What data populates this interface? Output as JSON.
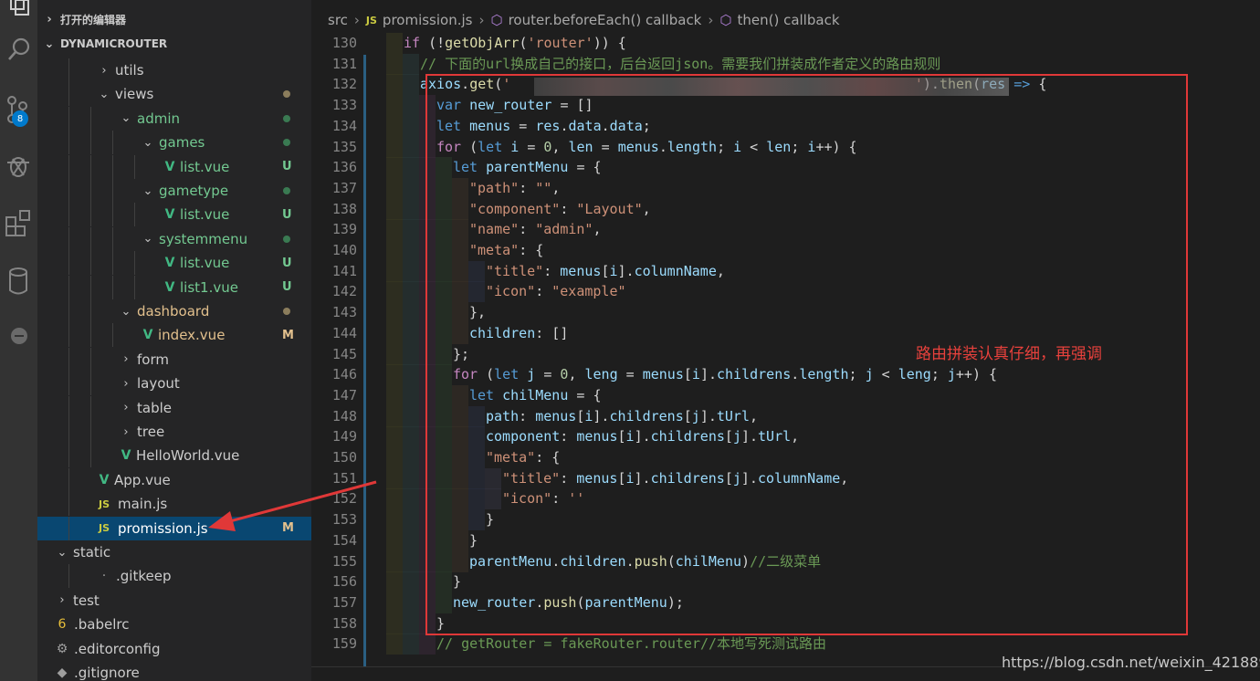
{
  "sidebar": {
    "open_editors": "打开的编辑器",
    "project": "DYNAMICROUTER",
    "activity_badge": "8",
    "tree": [
      {
        "label": "utils",
        "kind": "folder",
        "open": false,
        "depth": 1
      },
      {
        "label": "views",
        "kind": "folder",
        "open": true,
        "depth": 1,
        "status": "dot",
        "color": "#8b7d5c"
      },
      {
        "label": "admin",
        "kind": "folder",
        "open": true,
        "depth": 2,
        "status": "dot",
        "color": "#3a7a52",
        "text_color": "#73c991"
      },
      {
        "label": "games",
        "kind": "folder",
        "open": true,
        "depth": 3,
        "status": "dot",
        "color": "#3a7a52",
        "text_color": "#73c991"
      },
      {
        "label": "list.vue",
        "kind": "vue",
        "depth": 4,
        "status": "U",
        "text_color": "#73c991"
      },
      {
        "label": "gametype",
        "kind": "folder",
        "open": true,
        "depth": 3,
        "status": "dot",
        "color": "#3a7a52",
        "text_color": "#73c991"
      },
      {
        "label": "list.vue",
        "kind": "vue",
        "depth": 4,
        "status": "U",
        "text_color": "#73c991"
      },
      {
        "label": "systemmenu",
        "kind": "folder",
        "open": true,
        "depth": 3,
        "status": "dot",
        "color": "#3a7a52",
        "text_color": "#73c991"
      },
      {
        "label": "list.vue",
        "kind": "vue",
        "depth": 4,
        "status": "U",
        "text_color": "#73c991"
      },
      {
        "label": "list1.vue",
        "kind": "vue",
        "depth": 4,
        "status": "U",
        "text_color": "#73c991"
      },
      {
        "label": "dashboard",
        "kind": "folder",
        "open": true,
        "depth": 2,
        "status": "dot",
        "color": "#8b7d5c",
        "text_color": "#e2c08d"
      },
      {
        "label": "index.vue",
        "kind": "vue",
        "depth": 3,
        "status": "M",
        "text_color": "#e2c08d"
      },
      {
        "label": "form",
        "kind": "folder",
        "open": false,
        "depth": 2
      },
      {
        "label": "layout",
        "kind": "folder",
        "open": false,
        "depth": 2
      },
      {
        "label": "table",
        "kind": "folder",
        "open": false,
        "depth": 2
      },
      {
        "label": "tree",
        "kind": "folder",
        "open": false,
        "depth": 2
      },
      {
        "label": "HelloWorld.vue",
        "kind": "vue",
        "depth": 2
      },
      {
        "label": "App.vue",
        "kind": "vue",
        "depth": 1
      },
      {
        "label": "main.js",
        "kind": "js",
        "depth": 1
      },
      {
        "label": "promission.js",
        "kind": "js",
        "depth": 1,
        "status": "M",
        "selected": true
      },
      {
        "label": "static",
        "kind": "folder",
        "open": true,
        "depth": 0
      },
      {
        "label": ".gitkeep",
        "kind": "file",
        "depth": 1
      },
      {
        "label": "test",
        "kind": "folder",
        "open": false,
        "depth": 0
      },
      {
        "label": ".babelrc",
        "kind": "babel",
        "depth": 0
      },
      {
        "label": ".editorconfig",
        "kind": "gear",
        "depth": 0
      },
      {
        "label": ".gitignore",
        "kind": "git",
        "depth": 0
      }
    ]
  },
  "breadcrumb": {
    "root": "src",
    "file": "promission.js",
    "fn1": "router.beforeEach() callback",
    "fn2": "then() callback",
    "js_badge": "JS"
  },
  "editor": {
    "lines": [
      {
        "n": "130",
        "indent": 1,
        "t": [
          [
            "kw",
            "if "
          ],
          [
            "pn",
            "(!"
          ],
          [
            "fn",
            "getObjArr"
          ],
          [
            "pn",
            "("
          ],
          [
            "st",
            "'router'"
          ],
          [
            "pn",
            ")) {"
          ]
        ]
      },
      {
        "n": "131",
        "indent": 2,
        "t": [
          [
            "cm",
            "// 下面的url换成自己的接口，后台返回json。需要我们拼装成作者定义的路由规则"
          ]
        ]
      },
      {
        "n": "132",
        "indent": 2,
        "t": [
          [
            "vr",
            "axios"
          ],
          [
            "pn",
            "."
          ],
          [
            "fn",
            "get"
          ],
          [
            "pn",
            "("
          ],
          [
            "st",
            "'"
          ],
          [
            "pn",
            "                                                 "
          ],
          [
            "st",
            "'"
          ],
          [
            "pn",
            ")."
          ],
          [
            "fn",
            "then"
          ],
          [
            "pn",
            "("
          ],
          [
            "vr",
            "res"
          ],
          [
            "kwb",
            " =>"
          ],
          [
            "pn",
            " {"
          ]
        ]
      },
      {
        "n": "133",
        "indent": 3,
        "t": [
          [
            "kwb",
            "var "
          ],
          [
            "vr",
            "new_router"
          ],
          [
            "pn",
            " = []"
          ]
        ]
      },
      {
        "n": "134",
        "indent": 3,
        "t": [
          [
            "kwb",
            "let "
          ],
          [
            "vr",
            "menus"
          ],
          [
            "pn",
            " = "
          ],
          [
            "vr",
            "res"
          ],
          [
            "pn",
            "."
          ],
          [
            "vr",
            "data"
          ],
          [
            "pn",
            "."
          ],
          [
            "vr",
            "data"
          ],
          [
            "pn",
            ";"
          ]
        ]
      },
      {
        "n": "135",
        "indent": 3,
        "t": [
          [
            "kw",
            "for "
          ],
          [
            "pn",
            "("
          ],
          [
            "kwb",
            "let "
          ],
          [
            "vr",
            "i"
          ],
          [
            "pn",
            " = "
          ],
          [
            "nm",
            "0"
          ],
          [
            "pn",
            ", "
          ],
          [
            "vr",
            "len"
          ],
          [
            "pn",
            " = "
          ],
          [
            "vr",
            "menus"
          ],
          [
            "pn",
            "."
          ],
          [
            "vr",
            "length"
          ],
          [
            "pn",
            "; "
          ],
          [
            "vr",
            "i"
          ],
          [
            "pn",
            " < "
          ],
          [
            "vr",
            "len"
          ],
          [
            "pn",
            "; "
          ],
          [
            "vr",
            "i"
          ],
          [
            "pn",
            "++) {"
          ]
        ]
      },
      {
        "n": "136",
        "indent": 4,
        "t": [
          [
            "kwb",
            "let "
          ],
          [
            "vr",
            "parentMenu"
          ],
          [
            "pn",
            " = {"
          ]
        ]
      },
      {
        "n": "137",
        "indent": 5,
        "t": [
          [
            "st",
            "\"path\""
          ],
          [
            "pn",
            ": "
          ],
          [
            "st",
            "\"\""
          ],
          [
            "pn",
            ","
          ]
        ]
      },
      {
        "n": "138",
        "indent": 5,
        "t": [
          [
            "st",
            "\"component\""
          ],
          [
            "pn",
            ": "
          ],
          [
            "st",
            "\"Layout\""
          ],
          [
            "pn",
            ","
          ]
        ]
      },
      {
        "n": "139",
        "indent": 5,
        "t": [
          [
            "st",
            "\"name\""
          ],
          [
            "pn",
            ": "
          ],
          [
            "st",
            "\"admin\""
          ],
          [
            "pn",
            ","
          ]
        ]
      },
      {
        "n": "140",
        "indent": 5,
        "t": [
          [
            "st",
            "\"meta\""
          ],
          [
            "pn",
            ": {"
          ]
        ]
      },
      {
        "n": "141",
        "indent": 6,
        "t": [
          [
            "st",
            "\"title\""
          ],
          [
            "pn",
            ": "
          ],
          [
            "vr",
            "menus"
          ],
          [
            "pn",
            "["
          ],
          [
            "vr",
            "i"
          ],
          [
            "pn",
            "]."
          ],
          [
            "vr",
            "columnName"
          ],
          [
            "pn",
            ","
          ]
        ]
      },
      {
        "n": "142",
        "indent": 6,
        "t": [
          [
            "st",
            "\"icon\""
          ],
          [
            "pn",
            ": "
          ],
          [
            "st",
            "\"example\""
          ]
        ]
      },
      {
        "n": "143",
        "indent": 5,
        "t": [
          [
            "pn",
            "},"
          ]
        ]
      },
      {
        "n": "144",
        "indent": 5,
        "t": [
          [
            "vr",
            "children"
          ],
          [
            "pn",
            ": []"
          ]
        ]
      },
      {
        "n": "145",
        "indent": 4,
        "t": [
          [
            "pn",
            "};"
          ]
        ]
      },
      {
        "n": "146",
        "indent": 4,
        "t": [
          [
            "kw",
            "for "
          ],
          [
            "pn",
            "("
          ],
          [
            "kwb",
            "let "
          ],
          [
            "vr",
            "j"
          ],
          [
            "pn",
            " = "
          ],
          [
            "nm",
            "0"
          ],
          [
            "pn",
            ", "
          ],
          [
            "vr",
            "leng"
          ],
          [
            "pn",
            " = "
          ],
          [
            "vr",
            "menus"
          ],
          [
            "pn",
            "["
          ],
          [
            "vr",
            "i"
          ],
          [
            "pn",
            "]."
          ],
          [
            "vr",
            "childrens"
          ],
          [
            "pn",
            "."
          ],
          [
            "vr",
            "length"
          ],
          [
            "pn",
            "; "
          ],
          [
            "vr",
            "j"
          ],
          [
            "pn",
            " < "
          ],
          [
            "vr",
            "leng"
          ],
          [
            "pn",
            "; "
          ],
          [
            "vr",
            "j"
          ],
          [
            "pn",
            "++) {"
          ]
        ]
      },
      {
        "n": "147",
        "indent": 5,
        "t": [
          [
            "kwb",
            "let "
          ],
          [
            "vr",
            "chilMenu"
          ],
          [
            "pn",
            " = {"
          ]
        ]
      },
      {
        "n": "148",
        "indent": 6,
        "t": [
          [
            "vr",
            "path"
          ],
          [
            "pn",
            ": "
          ],
          [
            "vr",
            "menus"
          ],
          [
            "pn",
            "["
          ],
          [
            "vr",
            "i"
          ],
          [
            "pn",
            "]."
          ],
          [
            "vr",
            "childrens"
          ],
          [
            "pn",
            "["
          ],
          [
            "vr",
            "j"
          ],
          [
            "pn",
            "]."
          ],
          [
            "vr",
            "tUrl"
          ],
          [
            "pn",
            ","
          ]
        ]
      },
      {
        "n": "149",
        "indent": 6,
        "t": [
          [
            "vr",
            "component"
          ],
          [
            "pn",
            ": "
          ],
          [
            "vr",
            "menus"
          ],
          [
            "pn",
            "["
          ],
          [
            "vr",
            "i"
          ],
          [
            "pn",
            "]."
          ],
          [
            "vr",
            "childrens"
          ],
          [
            "pn",
            "["
          ],
          [
            "vr",
            "j"
          ],
          [
            "pn",
            "]."
          ],
          [
            "vr",
            "tUrl"
          ],
          [
            "pn",
            ","
          ]
        ]
      },
      {
        "n": "150",
        "indent": 6,
        "t": [
          [
            "st",
            "\"meta\""
          ],
          [
            "pn",
            ": {"
          ]
        ]
      },
      {
        "n": "151",
        "indent": 7,
        "t": [
          [
            "st",
            "\"title\""
          ],
          [
            "pn",
            ": "
          ],
          [
            "vr",
            "menus"
          ],
          [
            "pn",
            "["
          ],
          [
            "vr",
            "i"
          ],
          [
            "pn",
            "]."
          ],
          [
            "vr",
            "childrens"
          ],
          [
            "pn",
            "["
          ],
          [
            "vr",
            "j"
          ],
          [
            "pn",
            "]."
          ],
          [
            "vr",
            "columnName"
          ],
          [
            "pn",
            ","
          ]
        ]
      },
      {
        "n": "152",
        "indent": 7,
        "t": [
          [
            "st",
            "\"icon\""
          ],
          [
            "pn",
            ": "
          ],
          [
            "st",
            "''"
          ]
        ]
      },
      {
        "n": "153",
        "indent": 6,
        "t": [
          [
            "pn",
            "}"
          ]
        ]
      },
      {
        "n": "154",
        "indent": 5,
        "t": [
          [
            "pn",
            "}"
          ]
        ]
      },
      {
        "n": "155",
        "indent": 5,
        "t": [
          [
            "vr",
            "parentMenu"
          ],
          [
            "pn",
            "."
          ],
          [
            "vr",
            "children"
          ],
          [
            "pn",
            "."
          ],
          [
            "fn",
            "push"
          ],
          [
            "pn",
            "("
          ],
          [
            "vr",
            "chilMenu"
          ],
          [
            "pn",
            ")"
          ],
          [
            "cm",
            "//二级菜单"
          ]
        ]
      },
      {
        "n": "156",
        "indent": 4,
        "t": [
          [
            "pn",
            "}"
          ]
        ]
      },
      {
        "n": "157",
        "indent": 4,
        "t": [
          [
            "vr",
            "new_router"
          ],
          [
            "pn",
            "."
          ],
          [
            "fn",
            "push"
          ],
          [
            "pn",
            "("
          ],
          [
            "vr",
            "parentMenu"
          ],
          [
            "pn",
            ");"
          ]
        ]
      },
      {
        "n": "158",
        "indent": 3,
        "t": [
          [
            "pn",
            "}"
          ]
        ]
      },
      {
        "n": "159",
        "indent": 3,
        "t": [
          [
            "cm",
            "// "
          ],
          [
            "cm",
            "getRouter"
          ],
          [
            "cm",
            " = fakeRouter.router//本地写死测试路由"
          ]
        ]
      }
    ]
  },
  "annotation": {
    "note": "路由拼装认真仔细，再强调",
    "watermark": "https://blog.csdn.net/weixin_42188992"
  },
  "colors": {
    "annotation_red": "#e03838",
    "selection": "#094771",
    "untracked_green": "#73c991",
    "modified_amber": "#e2c08d"
  }
}
